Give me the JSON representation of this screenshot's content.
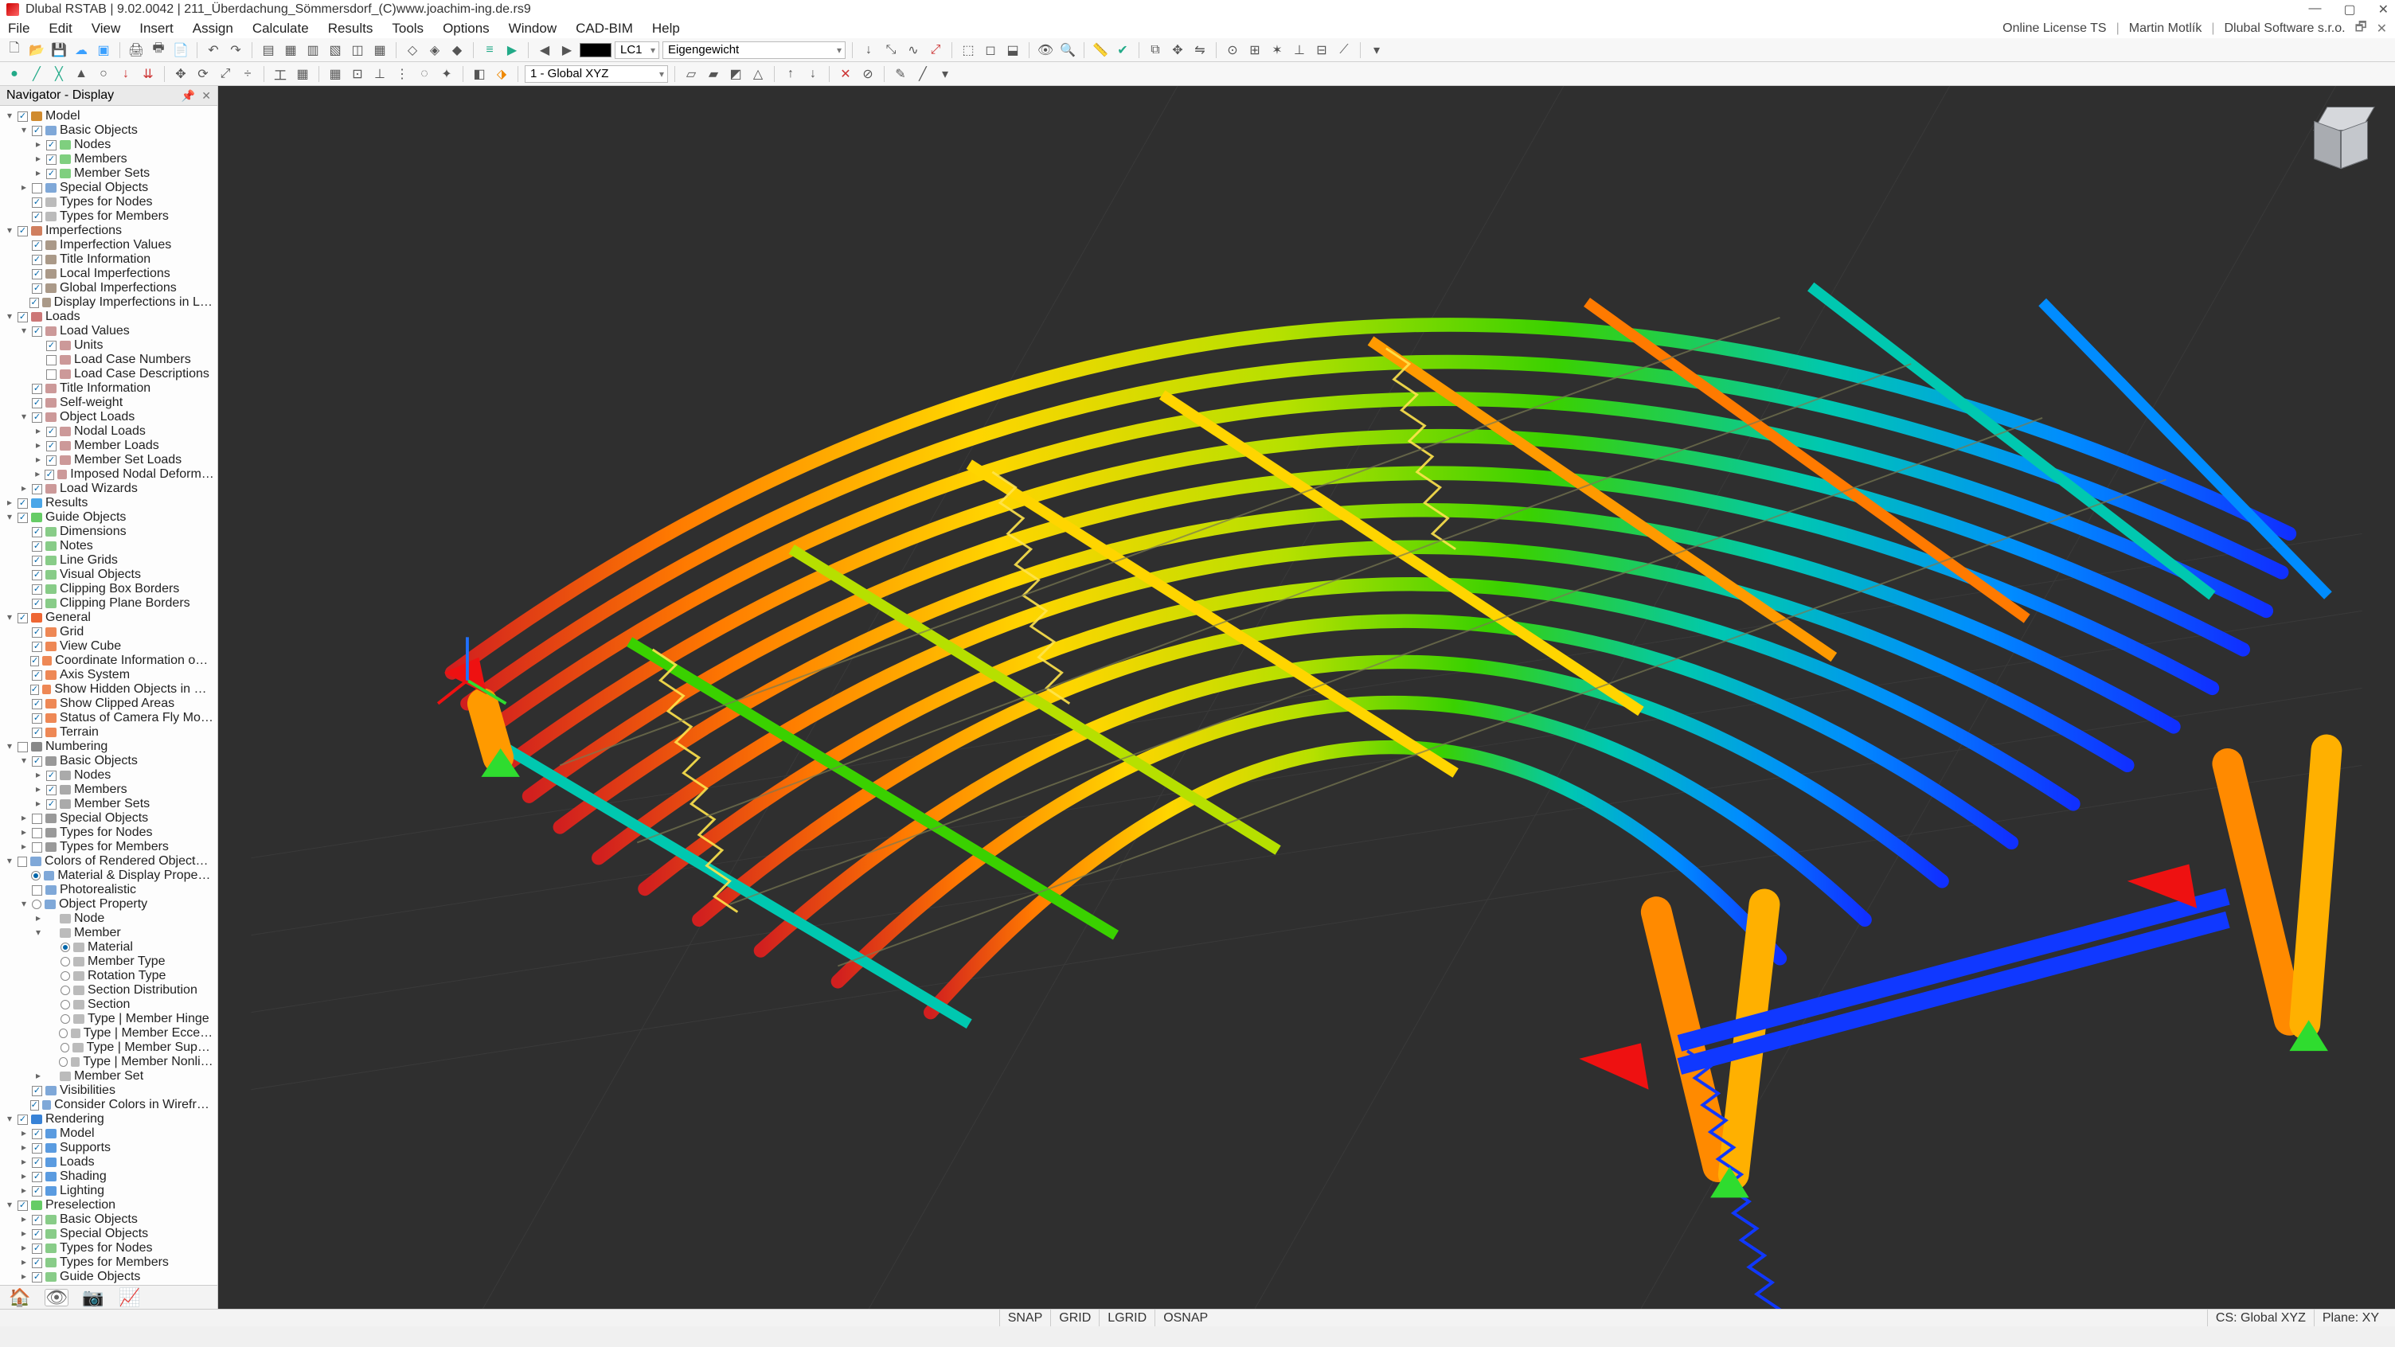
{
  "titlebar": {
    "app": "Dlubal RSTAB",
    "version": "9.02.0042",
    "file": "211_Überdachung_Sömmersdorf_(C)www.joachim-ing.de.rs9"
  },
  "menu": [
    "File",
    "Edit",
    "View",
    "Insert",
    "Assign",
    "Calculate",
    "Results",
    "Tools",
    "Options",
    "Window",
    "CAD-BIM",
    "Help"
  ],
  "license": {
    "type": "Online License TS",
    "user": "Martin Motlík",
    "company": "Dlubal Software s.r.o."
  },
  "toolbar1": {
    "lc_prefix": "LC1",
    "lc_label": "Eigengewicht"
  },
  "toolbar2": {
    "cs": "1 - Global XYZ"
  },
  "nav_title": "Navigator - Display",
  "tree": [
    {
      "d": 0,
      "a": "▾",
      "c": "on",
      "i": "#d08b2f",
      "t": "Model"
    },
    {
      "d": 1,
      "a": "▾",
      "c": "on",
      "i": "#7fa8d8",
      "t": "Basic Objects"
    },
    {
      "d": 2,
      "a": "▸",
      "c": "on",
      "i": "#7fcf7f",
      "t": "Nodes"
    },
    {
      "d": 2,
      "a": "▸",
      "c": "on",
      "i": "#7fcf7f",
      "t": "Members"
    },
    {
      "d": 2,
      "a": "▸",
      "c": "on",
      "i": "#7fcf7f",
      "t": "Member Sets"
    },
    {
      "d": 1,
      "a": "▸",
      "c": "off",
      "i": "#7fa8d8",
      "t": "Special Objects"
    },
    {
      "d": 1,
      "a": "",
      "c": "on",
      "i": "#bbb",
      "t": "Types for Nodes"
    },
    {
      "d": 1,
      "a": "",
      "c": "on",
      "i": "#bbb",
      "t": "Types for Members"
    },
    {
      "d": 0,
      "a": "▾",
      "c": "on",
      "i": "#d07f5f",
      "t": "Imperfections"
    },
    {
      "d": 1,
      "a": "",
      "c": "on",
      "i": "#a98",
      "t": "Imperfection Values"
    },
    {
      "d": 1,
      "a": "",
      "c": "on",
      "i": "#a98",
      "t": "Title Information"
    },
    {
      "d": 1,
      "a": "",
      "c": "on",
      "i": "#a98",
      "t": "Local Imperfections"
    },
    {
      "d": 1,
      "a": "",
      "c": "on",
      "i": "#a98",
      "t": "Global Imperfections"
    },
    {
      "d": 1,
      "a": "",
      "c": "on",
      "i": "#a98",
      "t": "Display Imperfections in Load Cas..."
    },
    {
      "d": 0,
      "a": "▾",
      "c": "on",
      "i": "#c77",
      "t": "Loads"
    },
    {
      "d": 1,
      "a": "▾",
      "c": "on",
      "i": "#c99",
      "t": "Load Values"
    },
    {
      "d": 2,
      "a": "",
      "c": "on",
      "i": "#c99",
      "t": "Units"
    },
    {
      "d": 2,
      "a": "",
      "c": "off",
      "i": "#c99",
      "t": "Load Case Numbers"
    },
    {
      "d": 2,
      "a": "",
      "c": "off",
      "i": "#c99",
      "t": "Load Case Descriptions"
    },
    {
      "d": 1,
      "a": "",
      "c": "on",
      "i": "#c99",
      "t": "Title Information"
    },
    {
      "d": 1,
      "a": "",
      "c": "on",
      "i": "#c99",
      "t": "Self-weight"
    },
    {
      "d": 1,
      "a": "▾",
      "c": "on",
      "i": "#c99",
      "t": "Object Loads"
    },
    {
      "d": 2,
      "a": "▸",
      "c": "on",
      "i": "#c99",
      "t": "Nodal Loads"
    },
    {
      "d": 2,
      "a": "▸",
      "c": "on",
      "i": "#c99",
      "t": "Member Loads"
    },
    {
      "d": 2,
      "a": "▸",
      "c": "on",
      "i": "#c99",
      "t": "Member Set Loads"
    },
    {
      "d": 2,
      "a": "▸",
      "c": "on",
      "i": "#c99",
      "t": "Imposed Nodal Deformations"
    },
    {
      "d": 1,
      "a": "▸",
      "c": "on",
      "i": "#c99",
      "t": "Load Wizards"
    },
    {
      "d": 0,
      "a": "▸",
      "c": "on",
      "i": "#4aa6e8",
      "t": "Results"
    },
    {
      "d": 0,
      "a": "▾",
      "c": "on",
      "i": "#6c6",
      "t": "Guide Objects"
    },
    {
      "d": 1,
      "a": "",
      "c": "on",
      "i": "#8c8",
      "t": "Dimensions"
    },
    {
      "d": 1,
      "a": "",
      "c": "on",
      "i": "#8c8",
      "t": "Notes"
    },
    {
      "d": 1,
      "a": "",
      "c": "on",
      "i": "#8c8",
      "t": "Line Grids"
    },
    {
      "d": 1,
      "a": "",
      "c": "on",
      "i": "#8c8",
      "t": "Visual Objects"
    },
    {
      "d": 1,
      "a": "",
      "c": "on",
      "i": "#8c8",
      "t": "Clipping Box Borders"
    },
    {
      "d": 1,
      "a": "",
      "c": "on",
      "i": "#8c8",
      "t": "Clipping Plane Borders"
    },
    {
      "d": 0,
      "a": "▾",
      "c": "on",
      "i": "#e63",
      "t": "General"
    },
    {
      "d": 1,
      "a": "",
      "c": "on",
      "i": "#e85",
      "t": "Grid"
    },
    {
      "d": 1,
      "a": "",
      "c": "on",
      "i": "#e85",
      "t": "View Cube"
    },
    {
      "d": 1,
      "a": "",
      "c": "on",
      "i": "#e85",
      "t": "Coordinate Information on Cursor"
    },
    {
      "d": 1,
      "a": "",
      "c": "on",
      "i": "#e85",
      "t": "Axis System"
    },
    {
      "d": 1,
      "a": "",
      "c": "on",
      "i": "#e85",
      "t": "Show Hidden Objects in Backgro..."
    },
    {
      "d": 1,
      "a": "",
      "c": "on",
      "i": "#e85",
      "t": "Show Clipped Areas"
    },
    {
      "d": 1,
      "a": "",
      "c": "on",
      "i": "#e85",
      "t": "Status of Camera Fly Mode"
    },
    {
      "d": 1,
      "a": "",
      "c": "on",
      "i": "#e85",
      "t": "Terrain"
    },
    {
      "d": 0,
      "a": "▾",
      "c": "off",
      "i": "#888",
      "t": "Numbering"
    },
    {
      "d": 1,
      "a": "▾",
      "c": "on",
      "i": "#999",
      "t": "Basic Objects"
    },
    {
      "d": 2,
      "a": "▸",
      "c": "on",
      "i": "#aaa",
      "t": "Nodes"
    },
    {
      "d": 2,
      "a": "▸",
      "c": "on",
      "i": "#aaa",
      "t": "Members"
    },
    {
      "d": 2,
      "a": "▸",
      "c": "on",
      "i": "#aaa",
      "t": "Member Sets"
    },
    {
      "d": 1,
      "a": "▸",
      "c": "off",
      "i": "#999",
      "t": "Special Objects"
    },
    {
      "d": 1,
      "a": "▸",
      "c": "off",
      "i": "#999",
      "t": "Types for Nodes"
    },
    {
      "d": 1,
      "a": "▸",
      "c": "off",
      "i": "#999",
      "t": "Types for Members"
    },
    {
      "d": 0,
      "a": "▾",
      "c": "off",
      "i": "#7fa8d8",
      "t": "Colors of Rendered Objects by"
    },
    {
      "d": 1,
      "a": "",
      "r": "on",
      "i": "#7fa8d8",
      "t": "Material & Display Properties"
    },
    {
      "d": 1,
      "a": "",
      "c": "off",
      "i": "#7fa8d8",
      "t": "Photorealistic"
    },
    {
      "d": 1,
      "a": "▾",
      "r": "off",
      "i": "#7fa8d8",
      "t": "Object Property"
    },
    {
      "d": 2,
      "a": "▸",
      "c": "",
      "i": "#bbb",
      "t": "Node"
    },
    {
      "d": 2,
      "a": "▾",
      "c": "",
      "i": "#bbb",
      "t": "Member"
    },
    {
      "d": 3,
      "a": "",
      "r": "on",
      "i": "#bbb",
      "t": "Material"
    },
    {
      "d": 3,
      "a": "",
      "r": "off",
      "i": "#bbb",
      "t": "Member Type"
    },
    {
      "d": 3,
      "a": "",
      "r": "off",
      "i": "#bbb",
      "t": "Rotation Type"
    },
    {
      "d": 3,
      "a": "",
      "r": "off",
      "i": "#bbb",
      "t": "Section Distribution"
    },
    {
      "d": 3,
      "a": "",
      "r": "off",
      "i": "#bbb",
      "t": "Section"
    },
    {
      "d": 3,
      "a": "",
      "r": "off",
      "i": "#bbb",
      "t": "Type | Member Hinge"
    },
    {
      "d": 3,
      "a": "",
      "r": "off",
      "i": "#bbb",
      "t": "Type | Member Eccentricity"
    },
    {
      "d": 3,
      "a": "",
      "r": "off",
      "i": "#bbb",
      "t": "Type | Member Support"
    },
    {
      "d": 3,
      "a": "",
      "r": "off",
      "i": "#bbb",
      "t": "Type | Member Nonlinearity"
    },
    {
      "d": 2,
      "a": "▸",
      "c": "",
      "i": "#bbb",
      "t": "Member Set"
    },
    {
      "d": 1,
      "a": "",
      "c": "on",
      "i": "#7fa8d8",
      "t": "Visibilities"
    },
    {
      "d": 1,
      "a": "",
      "c": "on",
      "i": "#7fa8d8",
      "t": "Consider Colors in Wireframe Mo..."
    },
    {
      "d": 0,
      "a": "▾",
      "c": "on",
      "i": "#3882d6",
      "t": "Rendering"
    },
    {
      "d": 1,
      "a": "▸",
      "c": "on",
      "i": "#5a9be0",
      "t": "Model"
    },
    {
      "d": 1,
      "a": "▸",
      "c": "on",
      "i": "#5a9be0",
      "t": "Supports"
    },
    {
      "d": 1,
      "a": "▸",
      "c": "on",
      "i": "#5a9be0",
      "t": "Loads"
    },
    {
      "d": 1,
      "a": "▸",
      "c": "on",
      "i": "#5a9be0",
      "t": "Shading"
    },
    {
      "d": 1,
      "a": "▸",
      "c": "on",
      "i": "#5a9be0",
      "t": "Lighting"
    },
    {
      "d": 0,
      "a": "▾",
      "c": "on",
      "i": "#6c6",
      "t": "Preselection"
    },
    {
      "d": 1,
      "a": "▸",
      "c": "on",
      "i": "#8c8",
      "t": "Basic Objects"
    },
    {
      "d": 1,
      "a": "▸",
      "c": "on",
      "i": "#8c8",
      "t": "Special Objects"
    },
    {
      "d": 1,
      "a": "▸",
      "c": "on",
      "i": "#8c8",
      "t": "Types for Nodes"
    },
    {
      "d": 1,
      "a": "▸",
      "c": "on",
      "i": "#8c8",
      "t": "Types for Members"
    },
    {
      "d": 1,
      "a": "▸",
      "c": "on",
      "i": "#8c8",
      "t": "Guide Objects"
    }
  ],
  "status": {
    "snap": "SNAP",
    "grid": "GRID",
    "lgrid": "LGRID",
    "osnap": "OSNAP",
    "cs": "CS: Global XYZ",
    "plane": "Plane: XY"
  }
}
